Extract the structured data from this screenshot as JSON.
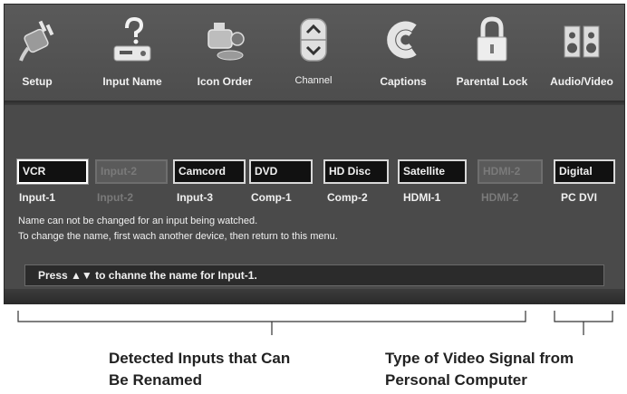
{
  "menu": {
    "items": [
      {
        "label": "Setup",
        "icon": "plug-icon"
      },
      {
        "label": "Input Name",
        "icon": "device-question-icon"
      },
      {
        "label": "Icon Order",
        "icon": "camcorder-icon"
      },
      {
        "label": "Channel",
        "icon": "updown-icon"
      },
      {
        "label": "Captions",
        "icon": "captions-icon"
      },
      {
        "label": "Parental Lock",
        "icon": "lock-icon"
      },
      {
        "label": "Audio/Video",
        "icon": "speakers-icon"
      }
    ]
  },
  "inputs": [
    {
      "name": "VCR",
      "sub": "Input-1",
      "state": "selected"
    },
    {
      "name": "Input-2",
      "sub": "Input-2",
      "state": "disabled"
    },
    {
      "name": "Camcord",
      "sub": "Input-3",
      "state": "normal"
    },
    {
      "name": "DVD",
      "sub": "Comp-1",
      "state": "normal"
    },
    {
      "name": "HD Disc",
      "sub": "Comp-2",
      "state": "normal"
    },
    {
      "name": "Satellite",
      "sub": "HDMI-1",
      "state": "normal"
    },
    {
      "name": "HDMI-2",
      "sub": "HDMI-2",
      "state": "disabled"
    },
    {
      "name": "Digital",
      "sub": "PC DVI",
      "state": "normal"
    }
  ],
  "notes": {
    "line1": "Name can not be changed for an input being watched.",
    "line2": "To change the name, first wach another device, then return to this menu."
  },
  "status": {
    "text": "Press ▲▼ to channe the name for Input-1."
  },
  "callouts": {
    "left": [
      "Detected Inputs that Can",
      "Be Renamed"
    ],
    "right": [
      "Type of Video Signal from",
      "Personal Computer"
    ]
  }
}
